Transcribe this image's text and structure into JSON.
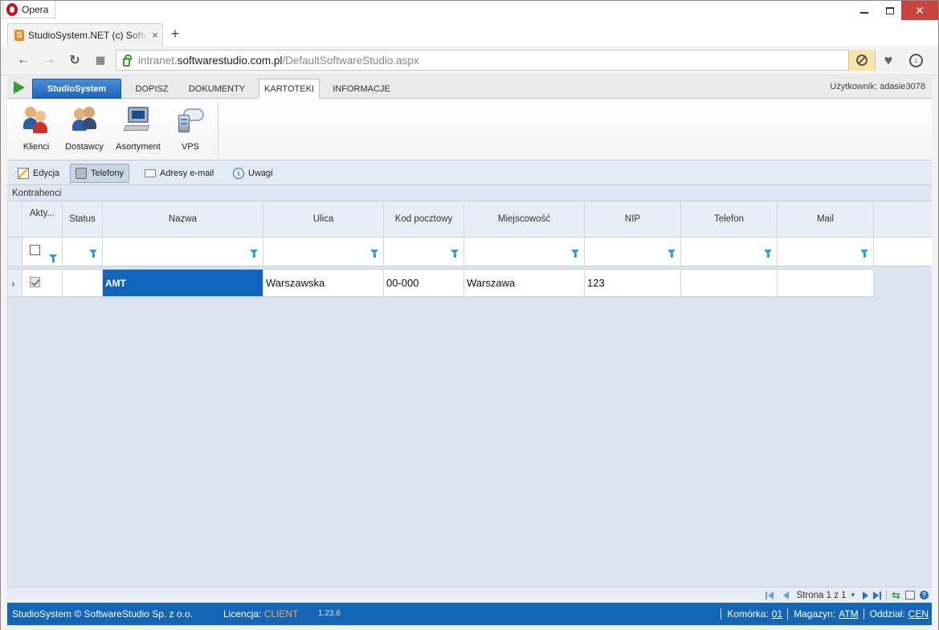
{
  "browser": {
    "app_name": "Opera",
    "tab_title": "StudioSystem.NET (c) SoftwareStudio",
    "tab_favicon": "S",
    "url_scheme_host": "intranet.",
    "url_domain": "softwarestudio.com.pl",
    "url_path": "/DefaultSoftwareStudio.aspx",
    "new_tab": "+",
    "close_tab": "×"
  },
  "app": {
    "tabs": [
      {
        "label": "StudioSystem"
      },
      {
        "label": "DOPISZ"
      },
      {
        "label": "DOKUMENTY"
      },
      {
        "label": "KARTOTEKI"
      },
      {
        "label": "INFORMACJE"
      }
    ],
    "user_label": "Użytkownik: adasie3078",
    "ribbon": [
      {
        "label": "Klienci",
        "icon": "clients-icon"
      },
      {
        "label": "Dostawcy",
        "icon": "suppliers-icon"
      },
      {
        "label": "Asortyment",
        "icon": "assortment-icon"
      },
      {
        "label": "VPS",
        "icon": "vps-icon"
      }
    ],
    "subtoolbar": [
      {
        "label": "Edycja",
        "icon": "edit-icon"
      },
      {
        "label": "Telefony",
        "icon": "phone-icon"
      },
      {
        "label": "Adresy e-mail",
        "icon": "email-icon"
      },
      {
        "label": "Uwagi",
        "icon": "info-icon"
      }
    ],
    "section_title": "Kontrahenci"
  },
  "grid": {
    "columns": [
      "Akty...",
      "Status",
      "Nazwa",
      "Ulica",
      "Kod pocztowy",
      "Miejscowość",
      "NIP",
      "Telefon",
      "Mail"
    ],
    "rows": [
      {
        "active": true,
        "status": "",
        "nazwa": "AMT",
        "ulica": "Warszawska",
        "kod": "00-000",
        "miejscowosc": "Warszawa",
        "nip": "123",
        "telefon": "",
        "mail": ""
      }
    ],
    "row_indicator": "›"
  },
  "pager": {
    "page_text": "Strona 1 z 1",
    "dropdown": "▾"
  },
  "statusbar": {
    "copyright": "StudioSystem © SoftwareStudio Sp. z o.o.",
    "license_label": "Licencja:",
    "license_value": "CLIENT",
    "version": "1.23.6",
    "komorka_label": "Komórka:",
    "komorka_value": "01",
    "magazyn_label": "Magazyn:",
    "magazyn_value": "ATM",
    "oddzial_label": "Oddział:",
    "oddzial_value": "CEN"
  },
  "colors": {
    "accent_blue": "#1565b5",
    "selected_cell": "#1166bb",
    "license_orange": "#f2a25c",
    "filter_icon": "#2b9fd0"
  }
}
